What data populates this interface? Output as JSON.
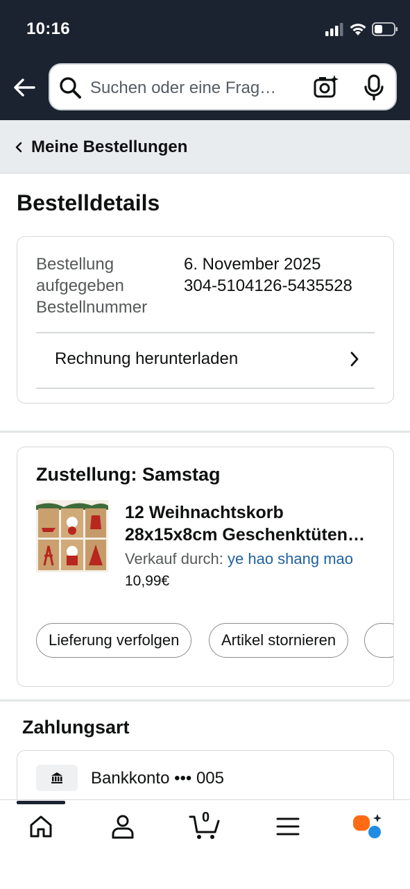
{
  "status": {
    "time": "10:16"
  },
  "search": {
    "placeholder": "Suchen oder eine Frag…"
  },
  "breadcrumb": {
    "label": "Meine Bestellungen"
  },
  "page": {
    "title": "Bestelldetails"
  },
  "order": {
    "placed_label_line1": "Bestellung",
    "placed_label_line2": "aufgegeben",
    "number_label": "Bestellnummer",
    "placed_value": "6. November 2025",
    "number_value": "304-5104126-5435528",
    "invoice_link": "Rechnung herunterladen"
  },
  "delivery": {
    "heading": "Zustellung: Samstag",
    "product_line1": "12 Weihnachtskorb",
    "product_line2": "28x15x8cm Geschenktüten…",
    "seller_prefix": "Verkauf durch:",
    "seller_name": "ye hao shang mao",
    "price": "10,99€",
    "buttons": [
      "Lieferung verfolgen",
      "Artikel stornieren"
    ]
  },
  "payment": {
    "heading": "Zahlungsart",
    "method": "Bankkonto ••• 005"
  },
  "nav": {
    "cart_count": "0",
    "items": [
      "home-icon",
      "account-icon",
      "cart-icon",
      "menu-icon",
      "rufus-icon"
    ]
  },
  "colors": {
    "header_bg": "#1b2230",
    "link": "#2162a1",
    "rufus_orange": "#ff6a14",
    "rufus_blue": "#1f8de4"
  }
}
